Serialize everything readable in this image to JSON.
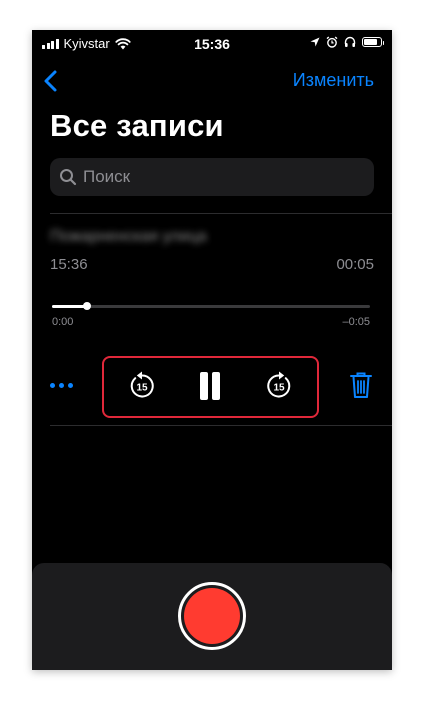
{
  "status_bar": {
    "carrier": "Kyivstar",
    "time": "15:36",
    "icons": [
      "signal-icon",
      "wifi-icon",
      "location-icon",
      "alarm-icon",
      "headphones-icon",
      "battery-icon"
    ],
    "battery_level": 0.85
  },
  "nav": {
    "back_icon": "chevron-left-icon",
    "edit_label": "Изменить"
  },
  "title": "Все записи",
  "search": {
    "placeholder": "Поиск",
    "value": "",
    "icon": "search-icon"
  },
  "recording": {
    "name": "Пожарненская улица",
    "time": "15:36",
    "duration": "00:05",
    "elapsed": "0:00",
    "remaining": "–0:05",
    "progress": 0.11
  },
  "controls": {
    "more_icon": "more-dots-icon",
    "skip_back_icon": "skip-back-15-icon",
    "skip_back_value": "15",
    "pause_icon": "pause-icon",
    "skip_forward_icon": "skip-forward-15-icon",
    "skip_forward_value": "15",
    "delete_icon": "trash-icon"
  },
  "record_button": {
    "icon": "record-icon"
  },
  "colors": {
    "accent": "#0a84ff",
    "highlight": "#e0283a",
    "record": "#ff3b30",
    "background": "#000000",
    "panel": "#1c1c1e"
  }
}
